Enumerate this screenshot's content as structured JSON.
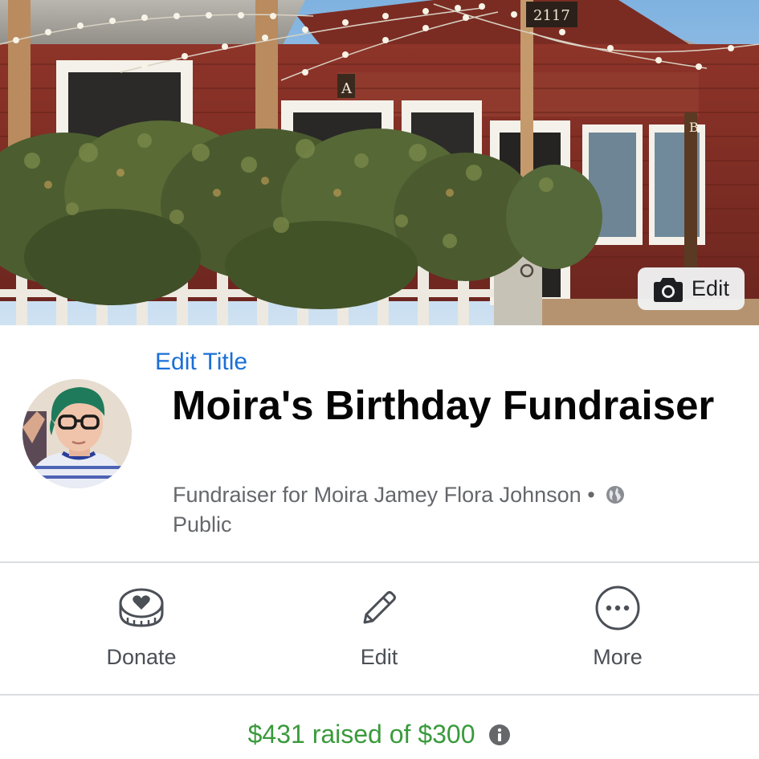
{
  "cover": {
    "edit_label": "Edit",
    "house_number": "2117",
    "sign_letter_a": "A",
    "sign_letter_b": "B"
  },
  "header": {
    "edit_title_label": "Edit Title",
    "title": "Moira's Birthday Fundraiser",
    "subtitle": "Fundraiser for Moira Jamey Flora Johnson",
    "separator": "•",
    "privacy": "Public"
  },
  "actions": [
    {
      "label": "Donate",
      "icon": "donate-heart-coin-icon"
    },
    {
      "label": "Edit",
      "icon": "pencil-icon"
    },
    {
      "label": "More",
      "icon": "more-dots-icon"
    }
  ],
  "progress": {
    "text": "$431 raised of $300",
    "raised_amount": 431,
    "goal_amount": 300
  },
  "colors": {
    "link_blue": "#1a6fd6",
    "raised_green": "#3a9a3c",
    "secondary_text": "#65676b",
    "divider": "#dadde1"
  }
}
